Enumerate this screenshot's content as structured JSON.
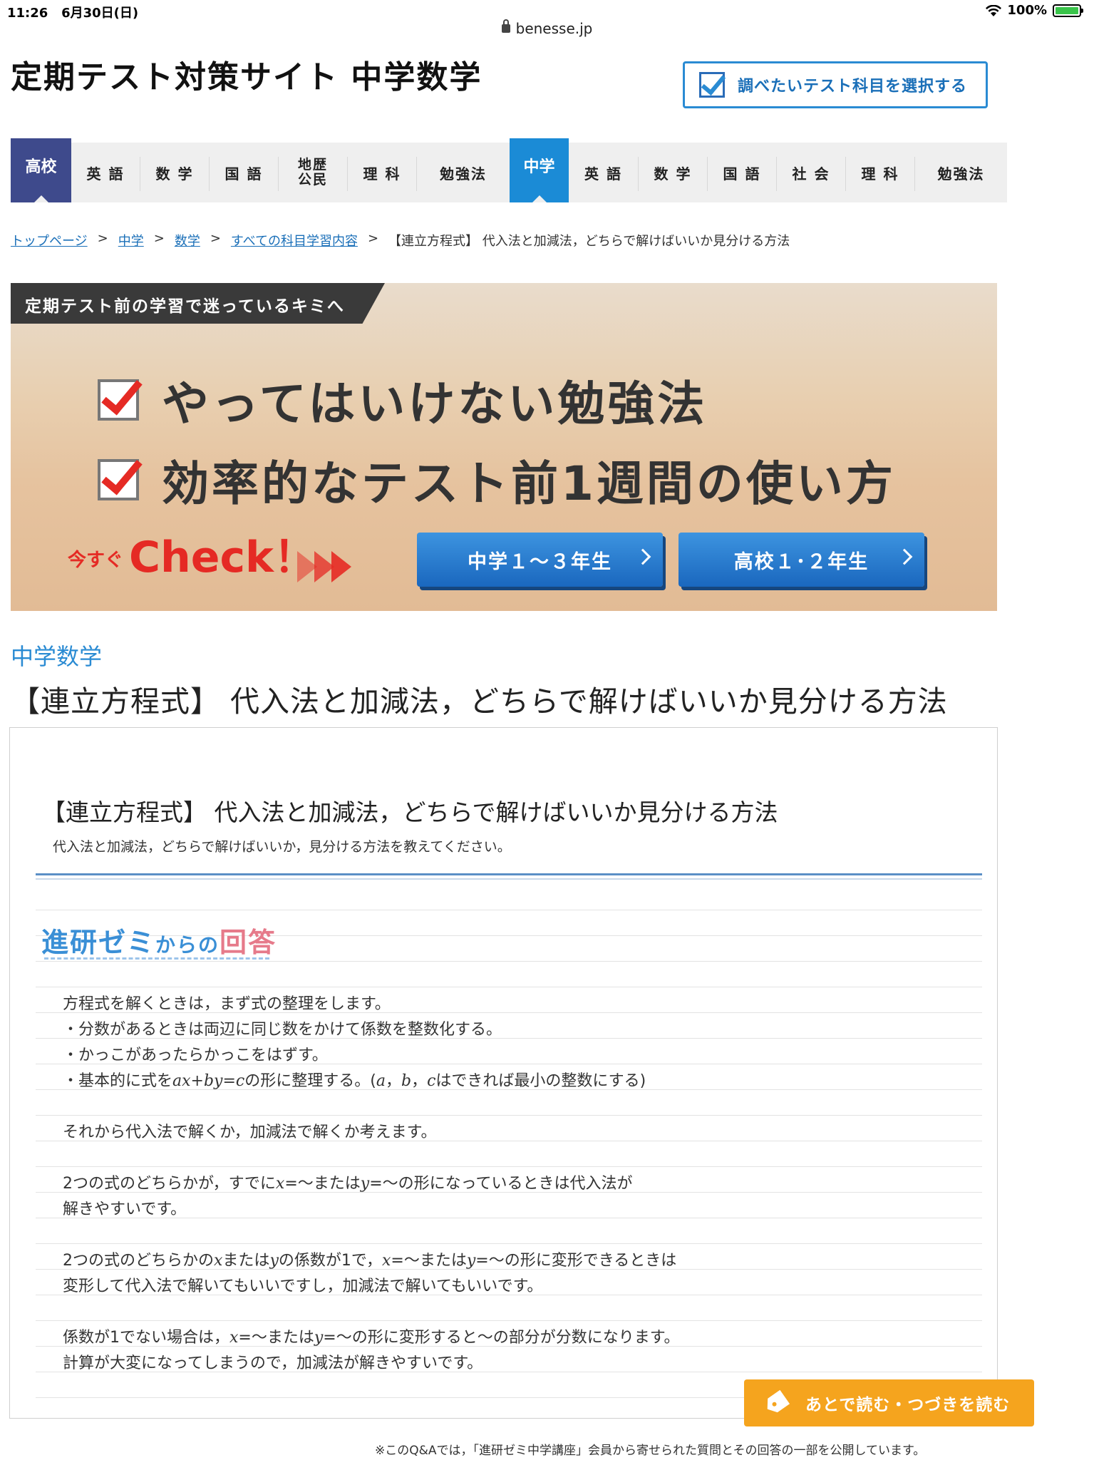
{
  "status": {
    "time": "11:26",
    "date": "6月30日(日)",
    "battery": "100%"
  },
  "browser": {
    "url": "benesse.jp"
  },
  "header": {
    "title": "定期テスト対策サイト 中学数学",
    "select_button": "調べたいテスト科目を選択する"
  },
  "nav": {
    "koko": "高校",
    "koko_items": [
      "英 語",
      "数 学",
      "国 語",
      "地歴",
      "公民",
      "理 科",
      "勉強法"
    ],
    "chu": "中学",
    "chu_items": [
      "英 語",
      "数 学",
      "国 語",
      "社 会",
      "理 科",
      "勉強法"
    ]
  },
  "breadcrumb": {
    "items": [
      "トップページ",
      "中学",
      "数学",
      "すべての科目学習内容"
    ],
    "current": "【連立方程式】 代入法と加減法，どちらで解けばいいか見分ける方法"
  },
  "banner": {
    "ribbon": "定期テスト前の学習で迷っているキミへ",
    "line1": "やってはいけない勉強法",
    "line2": "効率的なテスト前1週間の使い方",
    "check_prefix": "今すぐ",
    "check": "Check！",
    "button1": "中学１～３年生",
    "button2": "高校１･２年生"
  },
  "content": {
    "category": "中学数学",
    "heading": "【連立方程式】 代入法と加減法，どちらで解けばいいか見分ける方法"
  },
  "qa": {
    "title": "【連立方程式】 代入法と加減法，どちらで解けばいいか見分ける方法",
    "subtitle": "代入法と加減法，どちらで解けばいいか，見分ける方法を教えてください。",
    "answer_head_a": "進研ゼミ",
    "answer_head_b": "からの",
    "answer_head_c": "回答",
    "p1": "方程式を解くときは，まず式の整理をします。",
    "p2": "・分数があるときは両辺に同じ数をかけて係数を整数化する。",
    "p3": "・かっこがあったらかっこをはずす。",
    "p4a": "・基本的に式を",
    "p4b": "ax+by=c",
    "p4c": "の形に整理する。(",
    "p4d": "a",
    "p4e": "，",
    "p4f": "b",
    "p4g": "，",
    "p4h": "c",
    "p4i": "はできれば最小の整数にする)",
    "p5": "それから代入法で解くか，加減法で解くか考えます。",
    "p6a": "2つの式のどちらかが，すでに",
    "p6b": "x",
    "p6c": "=～または",
    "p6d": "y",
    "p6e": "=～の形になっているときは代入法が",
    "p6f": "解きやすいです。",
    "p7a": "2つの式のどちらかの",
    "p7b": "x",
    "p7c": "または",
    "p7d": "y",
    "p7e": "の係数が1で，",
    "p7f": "x",
    "p7g": "=～または",
    "p7h": "y",
    "p7i": "=～の形に変形できるときは",
    "p7j": "変形して代入法で解いてもいいですし，加減法で解いてもいいです。",
    "p8a": "係数が1でない場合は，",
    "p8b": "x",
    "p8c": "=～または",
    "p8d": "y",
    "p8e": "=～の形に変形すると～の部分が分数になります。",
    "p8f": "計算が大変になってしまうので，加減法が解きやすいです。"
  },
  "later_button": "あとで読む・つづきを読む",
  "footnote": "※このQ&Aでは，「進研ゼミ中学講座」会員から寄せられた質問とその回答の一部を公開しています。"
}
